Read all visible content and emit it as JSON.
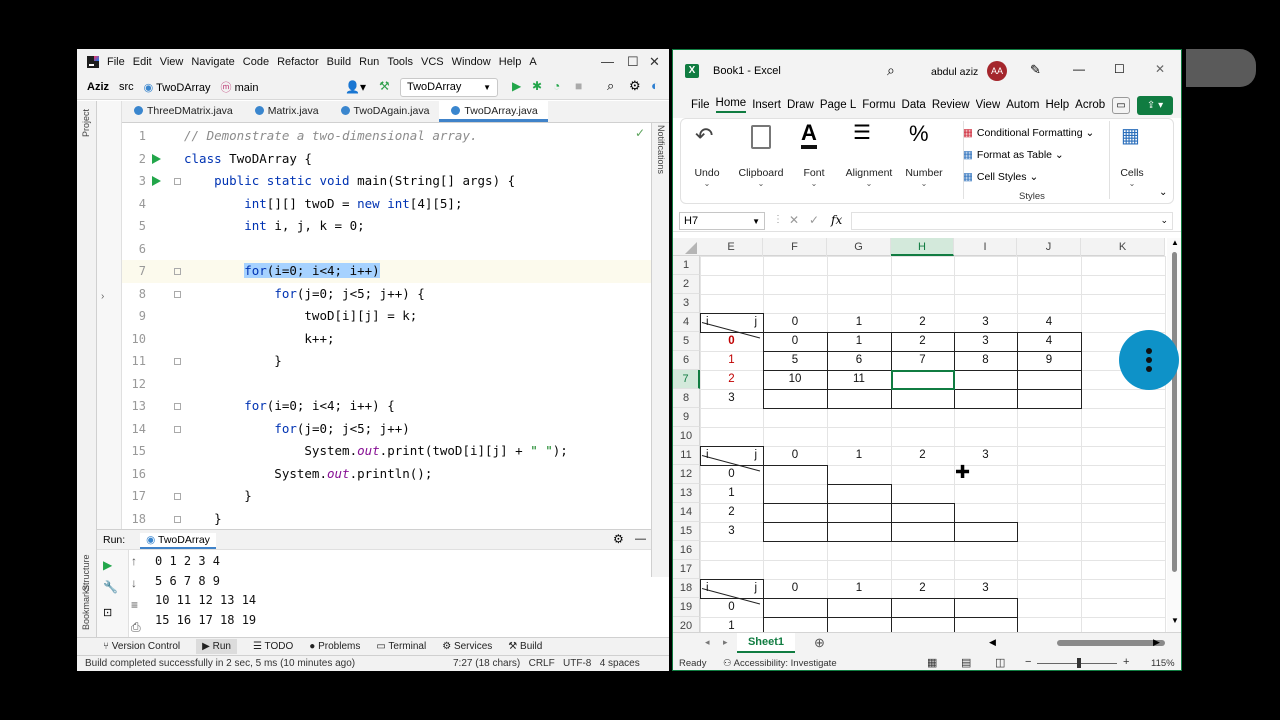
{
  "ide": {
    "menu": [
      "File",
      "Edit",
      "View",
      "Navigate",
      "Code",
      "Refactor",
      "Build",
      "Run",
      "Tools",
      "VCS",
      "Window",
      "Help",
      "A"
    ],
    "nav": {
      "project": "Aziz",
      "folder": "src",
      "file": "TwoDArray",
      "method": "main"
    },
    "run_config": "TwoDArray",
    "tabs": [
      "ThreeDMatrix.java",
      "Matrix.java",
      "TwoDAgain.java",
      "TwoDArray.java"
    ],
    "left_labels": {
      "project": "Project",
      "structure": "Structure",
      "bookmarks": "Bookmarks"
    },
    "right_label": "Notifications",
    "code_lines": [
      {
        "n": "1",
        "html": "<span class=\"cm\">// Demonstrate a two-dimensional array.</span>"
      },
      {
        "n": "2",
        "html": "<span class=\"kw\">class</span> TwoDArray {"
      },
      {
        "n": "3",
        "html": "    <span class=\"kw\">public static void</span> main(String[] args) {"
      },
      {
        "n": "4",
        "html": "        <span class=\"kw\">int</span>[][] twoD = <span class=\"kw\">new int</span>[4][5];"
      },
      {
        "n": "5",
        "html": "        <span class=\"kw\">int</span> i, j, k = 0;"
      },
      {
        "n": "6",
        "html": ""
      },
      {
        "n": "7",
        "html": "        <span class=\"sel\"><span class=\"kw\">for</span>(i=0; i&lt;4; i++)</span>"
      },
      {
        "n": "8",
        "html": "            <span class=\"kw\">for</span>(j=0; j&lt;5; j++) {"
      },
      {
        "n": "9",
        "html": "                twoD[i][j] = k;"
      },
      {
        "n": "10",
        "html": "                k++;"
      },
      {
        "n": "11",
        "html": "            }"
      },
      {
        "n": "12",
        "html": ""
      },
      {
        "n": "13",
        "html": "        <span class=\"kw\">for</span>(i=0; i&lt;4; i++) {"
      },
      {
        "n": "14",
        "html": "            <span class=\"kw\">for</span>(j=0; j&lt;5; j++)"
      },
      {
        "n": "15",
        "html": "                System.<span class=\"it\">out</span>.print(twoD[i][j] + <span class=\"st\">\" \"</span>);"
      },
      {
        "n": "16",
        "html": "            System.<span class=\"it\">out</span>.println();"
      },
      {
        "n": "17",
        "html": "        }"
      },
      {
        "n": "18",
        "html": "    }"
      }
    ],
    "run_label": "Run:",
    "run_tab": "TwoDArray",
    "output": [
      "0 1 2 3 4",
      "5 6 7 8 9",
      "10 11 12 13 14",
      "15 16 17 18 19"
    ],
    "bottom_tabs": [
      "Version Control",
      "Run",
      "TODO",
      "Problems",
      "Terminal",
      "Services",
      "Build"
    ],
    "status_msg": "Build completed successfully in 2 sec, 5 ms (10 minutes ago)",
    "status_right": "7:27 (18 chars)   CRLF   UTF-8   4 spaces"
  },
  "excel": {
    "title": "Book1 - Excel",
    "user": "abdul aziz",
    "initials": "AA",
    "tabs": [
      "File",
      "Home",
      "Insert",
      "Draw",
      "Page L",
      "Formu",
      "Data",
      "Review",
      "View",
      "Autom",
      "Help",
      "Acrob"
    ],
    "ribbon": {
      "undo": "Undo",
      "clipboard": "Clipboard",
      "font": "Font",
      "alignment": "Alignment",
      "number": "Number",
      "cond": "Conditional Formatting",
      "fmt_table": "Format as Table",
      "cell_styles": "Cell Styles",
      "styles": "Styles",
      "cells": "Cells"
    },
    "namebox": "H7",
    "fx": "fx",
    "columns": [
      "E",
      "F",
      "G",
      "H",
      "I",
      "J",
      "K"
    ],
    "rows": [
      "1",
      "2",
      "3",
      "4",
      "5",
      "6",
      "7",
      "8",
      "9",
      "10",
      "11",
      "12",
      "13",
      "14",
      "15",
      "16",
      "17",
      "18",
      "19",
      "20"
    ],
    "cells": [
      {
        "r": 4,
        "c": 0,
        "v": "i",
        "align": "left"
      },
      {
        "r": 4,
        "c": 0,
        "v": "j",
        "align": "right"
      },
      {
        "r": 4,
        "c": 1,
        "v": "0"
      },
      {
        "r": 4,
        "c": 2,
        "v": "1"
      },
      {
        "r": 4,
        "c": 3,
        "v": "2"
      },
      {
        "r": 4,
        "c": 4,
        "v": "3"
      },
      {
        "r": 4,
        "c": 5,
        "v": "4"
      },
      {
        "r": 5,
        "c": 0,
        "v": "0",
        "color": "#c00000",
        "bold": true
      },
      {
        "r": 5,
        "c": 1,
        "v": "0"
      },
      {
        "r": 5,
        "c": 2,
        "v": "1"
      },
      {
        "r": 5,
        "c": 3,
        "v": "2"
      },
      {
        "r": 5,
        "c": 4,
        "v": "3"
      },
      {
        "r": 5,
        "c": 5,
        "v": "4"
      },
      {
        "r": 6,
        "c": 0,
        "v": "1",
        "color": "#c00000"
      },
      {
        "r": 6,
        "c": 1,
        "v": "5"
      },
      {
        "r": 6,
        "c": 2,
        "v": "6"
      },
      {
        "r": 6,
        "c": 3,
        "v": "7"
      },
      {
        "r": 6,
        "c": 4,
        "v": "8"
      },
      {
        "r": 6,
        "c": 5,
        "v": "9"
      },
      {
        "r": 7,
        "c": 0,
        "v": "2",
        "color": "#c00000"
      },
      {
        "r": 7,
        "c": 1,
        "v": "10"
      },
      {
        "r": 7,
        "c": 2,
        "v": "11"
      },
      {
        "r": 8,
        "c": 0,
        "v": "3"
      },
      {
        "r": 11,
        "c": 0,
        "v": "i",
        "align": "left"
      },
      {
        "r": 11,
        "c": 0,
        "v": "j",
        "align": "right"
      },
      {
        "r": 11,
        "c": 1,
        "v": "0"
      },
      {
        "r": 11,
        "c": 2,
        "v": "1"
      },
      {
        "r": 11,
        "c": 3,
        "v": "2"
      },
      {
        "r": 11,
        "c": 4,
        "v": "3"
      },
      {
        "r": 12,
        "c": 0,
        "v": "0"
      },
      {
        "r": 13,
        "c": 0,
        "v": "1"
      },
      {
        "r": 14,
        "c": 0,
        "v": "2"
      },
      {
        "r": 15,
        "c": 0,
        "v": "3"
      },
      {
        "r": 18,
        "c": 0,
        "v": "i",
        "align": "left"
      },
      {
        "r": 18,
        "c": 0,
        "v": "j",
        "align": "right"
      },
      {
        "r": 18,
        "c": 1,
        "v": "0"
      },
      {
        "r": 18,
        "c": 2,
        "v": "1"
      },
      {
        "r": 18,
        "c": 3,
        "v": "2"
      },
      {
        "r": 18,
        "c": 4,
        "v": "3"
      },
      {
        "r": 19,
        "c": 0,
        "v": "0"
      },
      {
        "r": 20,
        "c": 0,
        "v": "1"
      }
    ],
    "sheet": "Sheet1",
    "status_ready": "Ready",
    "accessibility": "Accessibility: Investigate",
    "zoom": "115%"
  },
  "colors": {
    "excel_green": "#107c41",
    "intellij_blue": "#4083c9",
    "fab_blue": "#0e92c8",
    "selection": "#a6d2ff"
  }
}
